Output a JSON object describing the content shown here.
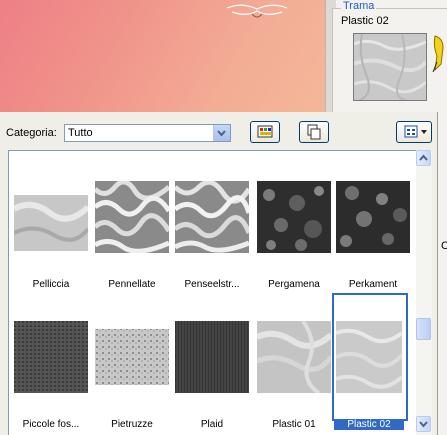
{
  "trama": {
    "title": "Trama",
    "value": "Plastic 02"
  },
  "right_strip": {
    "letter": "C"
  },
  "toolbar": {
    "category_label": "Categoria:",
    "category_value": "Tutto",
    "buttons": [
      "palette-icon",
      "copy-icon",
      "view-options-icon"
    ]
  },
  "textures": [
    {
      "name": "Pelliccia"
    },
    {
      "name": "Pennellate"
    },
    {
      "name": "Penseelstr..."
    },
    {
      "name": "Pergamena"
    },
    {
      "name": "Perkament"
    },
    {
      "name": "Piccole fos..."
    },
    {
      "name": "Pietruzze"
    },
    {
      "name": "Plaid"
    },
    {
      "name": "Plastic 01"
    },
    {
      "name": "Plastic 02",
      "selected": true
    }
  ],
  "colors": {
    "selection": "#316ac5",
    "accent_title": "#1c5bd0"
  }
}
